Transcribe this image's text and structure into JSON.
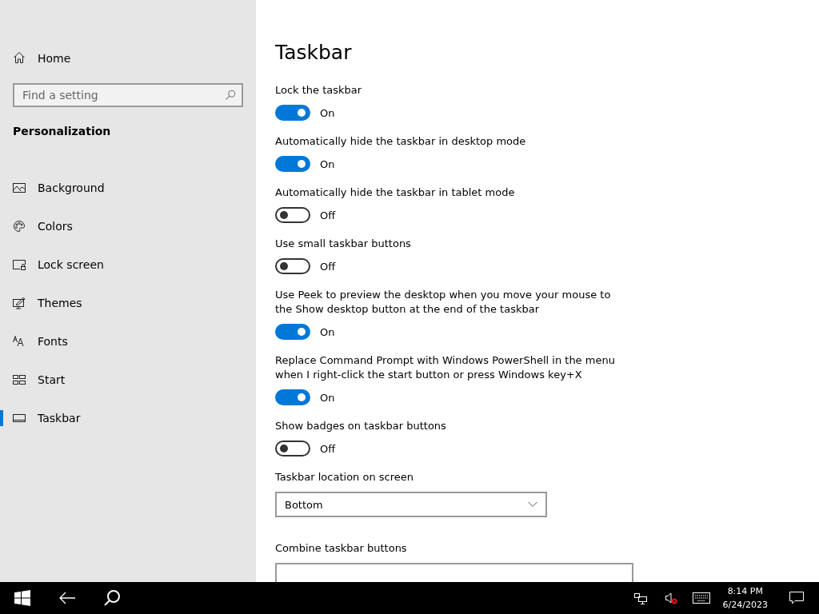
{
  "sidebar": {
    "home": "Home",
    "search": {
      "placeholder": "Find a setting"
    },
    "section": "Personalization",
    "items": [
      {
        "label": "Background",
        "selected": false
      },
      {
        "label": "Colors",
        "selected": false
      },
      {
        "label": "Lock screen",
        "selected": false
      },
      {
        "label": "Themes",
        "selected": false
      },
      {
        "label": "Fonts",
        "selected": false
      },
      {
        "label": "Start",
        "selected": false
      },
      {
        "label": "Taskbar",
        "selected": true
      }
    ]
  },
  "page": {
    "title": "Taskbar",
    "settings": [
      {
        "kind": "toggle",
        "label": "Lock the taskbar",
        "on": true,
        "state": "On"
      },
      {
        "kind": "toggle",
        "label": "Automatically hide the taskbar in desktop mode",
        "on": true,
        "state": "On"
      },
      {
        "kind": "toggle",
        "label": "Automatically hide the taskbar in tablet mode",
        "on": false,
        "state": "Off"
      },
      {
        "kind": "toggle",
        "label": "Use small taskbar buttons",
        "on": false,
        "state": "Off"
      },
      {
        "kind": "toggle",
        "label": "Use Peek to preview the desktop when you move your mouse to the Show desktop button at the end of the taskbar",
        "on": true,
        "state": "On"
      },
      {
        "kind": "toggle",
        "label": "Replace Command Prompt with Windows PowerShell in the menu when I right-click the start button or press Windows key+X",
        "on": true,
        "state": "On"
      },
      {
        "kind": "toggle",
        "label": "Show badges on taskbar buttons",
        "on": false,
        "state": "Off"
      },
      {
        "kind": "dropdown",
        "label": "Taskbar location on screen",
        "value": "Bottom"
      },
      {
        "kind": "dropdown",
        "label": "Combine taskbar buttons"
      }
    ]
  },
  "taskbar": {
    "time": "8:14 PM",
    "date": "6/24/2023"
  }
}
